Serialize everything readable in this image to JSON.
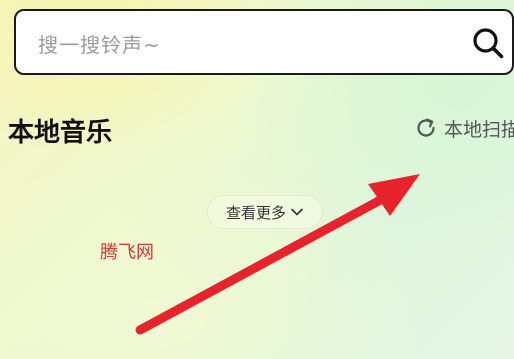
{
  "search": {
    "placeholder": "搜一搜铃声~"
  },
  "section": {
    "title": "本地音乐",
    "scan_label": "本地扫描"
  },
  "more": {
    "label": "查看更多"
  },
  "watermark": {
    "text": "腾飞网"
  },
  "colors": {
    "annotation_arrow": "#e8232b",
    "watermark": "#d43a34"
  },
  "icons": {
    "search": "search-icon",
    "refresh": "refresh-icon",
    "chevron": "chevron-down-icon"
  }
}
